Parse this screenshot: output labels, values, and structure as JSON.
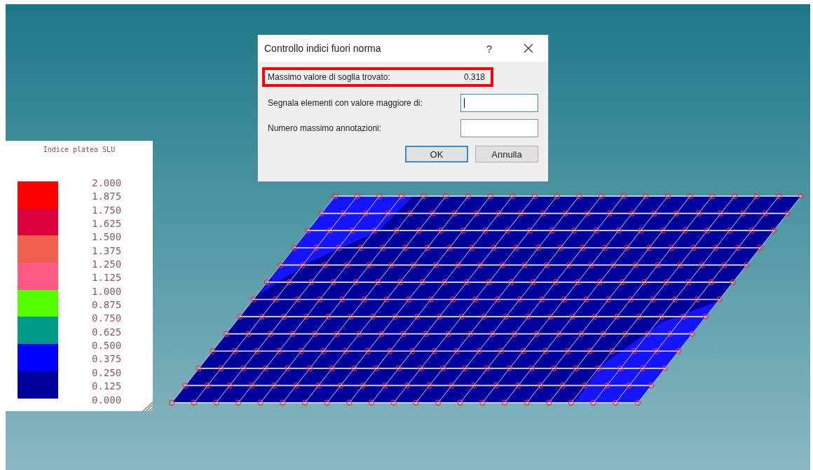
{
  "dialog": {
    "title": "Controllo indici fuori norma",
    "help": "?",
    "result": {
      "label": "Massimo valore di soglia trovato:",
      "value": "0.318",
      "highlighted": true
    },
    "fields": [
      {
        "label": "Segnala elementi con valore maggiore di:",
        "focused": true
      },
      {
        "label": "Numero massimo annotazioni:",
        "focused": false
      }
    ],
    "buttons": [
      {
        "label": "OK",
        "default": true
      },
      {
        "label": "Annulla",
        "default": false
      }
    ]
  },
  "legend": {
    "title": "Indice platea SLU",
    "swatches": [
      {
        "color": "#ff0000"
      },
      {
        "color": "#dc003c"
      },
      {
        "color": "#f0604c"
      },
      {
        "color": "#ff5a82"
      },
      {
        "color": "#55ff00"
      },
      {
        "color": "#009a88"
      },
      {
        "color": "#0000ff"
      },
      {
        "color": "#00009a"
      }
    ],
    "labels": [
      "2.000",
      "1.875",
      "1.750",
      "1.625",
      "1.500",
      "1.375",
      "1.250",
      "1.125",
      "1.000",
      "0.875",
      "0.750",
      "0.625",
      "0.500",
      "0.375",
      "0.250",
      "0.125",
      "0.000"
    ]
  }
}
